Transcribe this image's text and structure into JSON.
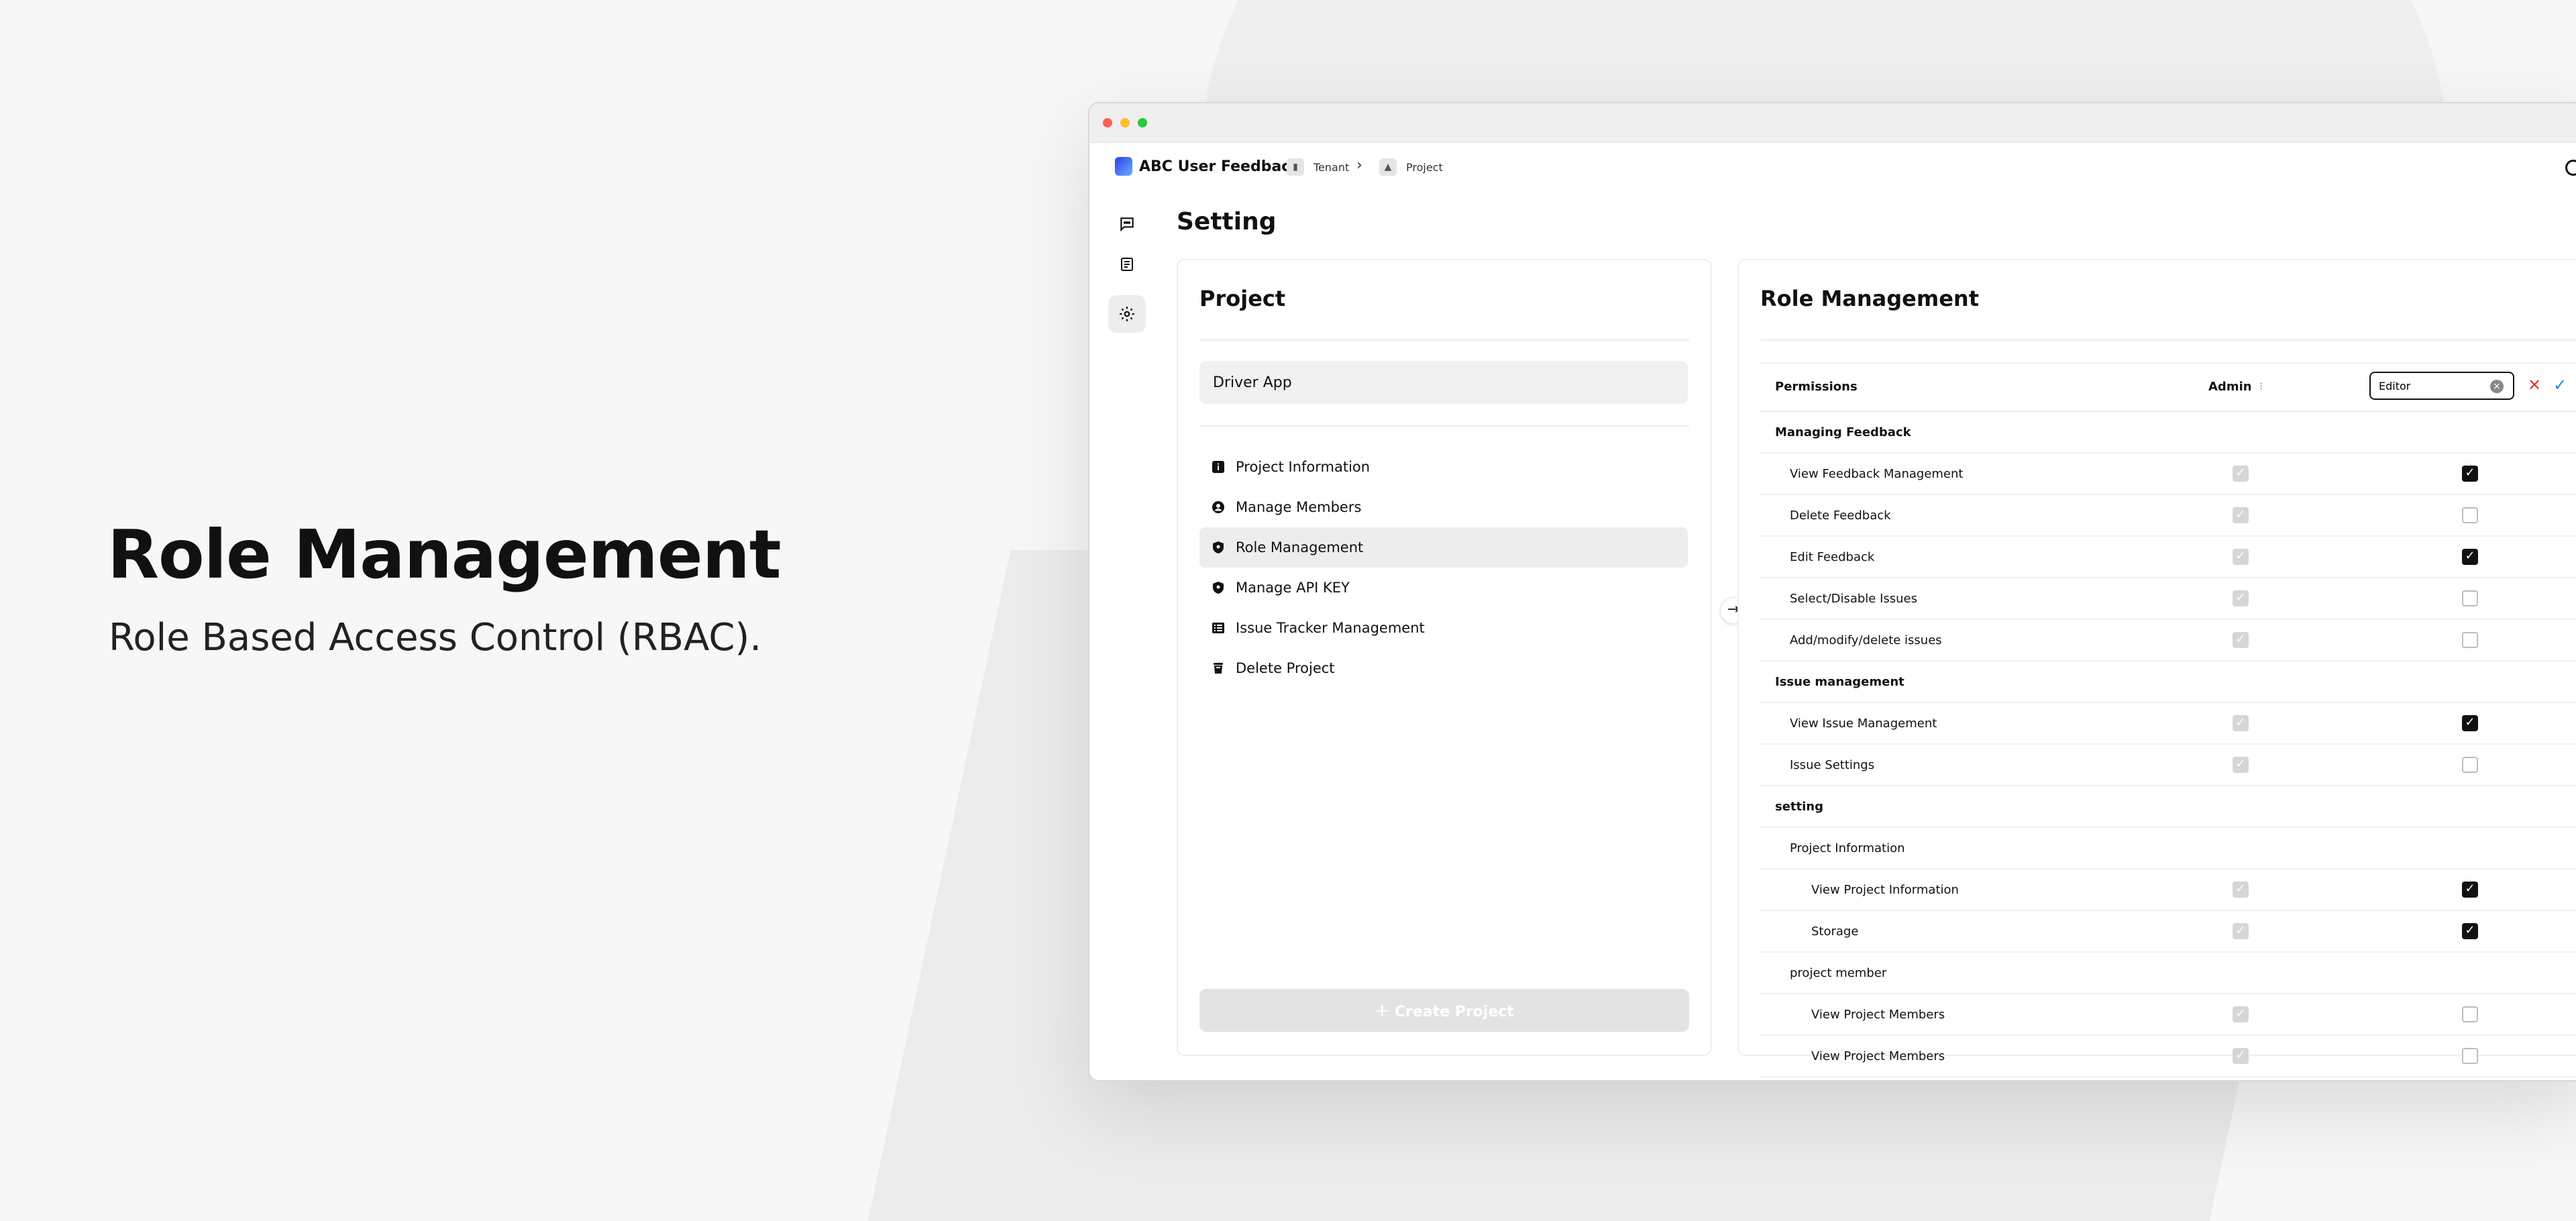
{
  "hero": {
    "title": "Role Management",
    "subtitle": "Role Based Access Control (RBAC)."
  },
  "app": {
    "name": "ABC User Feedback",
    "breadcrumb": [
      {
        "icon": "tenant-icon",
        "label": "Tenant"
      },
      {
        "icon": "project-icon",
        "label": "Project"
      }
    ]
  },
  "sidebar_nav": [
    {
      "icon": "feedback-icon",
      "active": false
    },
    {
      "icon": "issue-icon",
      "active": false
    },
    {
      "icon": "gear-icon",
      "active": true
    }
  ],
  "page": {
    "title": "Setting"
  },
  "project_panel": {
    "title": "Project",
    "selected_project": "Driver App",
    "menu": [
      {
        "icon": "info-icon",
        "label": "Project Information",
        "active": false
      },
      {
        "icon": "user-circle-icon",
        "label": "Manage Members",
        "active": false
      },
      {
        "icon": "shield-icon",
        "label": "Role Management",
        "active": true
      },
      {
        "icon": "shield-icon",
        "label": "Manage API KEY",
        "active": false
      },
      {
        "icon": "list-icon",
        "label": "Issue Tracker Management",
        "active": false
      },
      {
        "icon": "trash-icon",
        "label": "Delete Project",
        "active": false
      }
    ],
    "create_button": "Create Project"
  },
  "role_panel": {
    "title": "Role Management",
    "columns": {
      "permissions": "Permissions",
      "admin": "Admin",
      "admin_cursor": "⁝",
      "editor_value": "Editor"
    },
    "rows": [
      {
        "level": "group",
        "label": "Managing Feedback"
      },
      {
        "level": "sub",
        "label": "View Feedback Management",
        "admin": true,
        "editor": true
      },
      {
        "level": "sub",
        "label": "Delete Feedback",
        "admin": true,
        "editor": false
      },
      {
        "level": "sub",
        "label": "Edit Feedback",
        "admin": true,
        "editor": true
      },
      {
        "level": "sub",
        "label": "Select/Disable Issues",
        "admin": true,
        "editor": false
      },
      {
        "level": "sub",
        "label": "Add/modify/delete issues",
        "admin": true,
        "editor": false
      },
      {
        "level": "group",
        "label": "Issue management"
      },
      {
        "level": "sub",
        "label": "View Issue Management",
        "admin": true,
        "editor": true
      },
      {
        "level": "sub",
        "label": "Issue Settings",
        "admin": true,
        "editor": false
      },
      {
        "level": "group",
        "label": "setting"
      },
      {
        "level": "sub-plain",
        "label": "Project Information"
      },
      {
        "level": "subsub",
        "label": "View Project Information",
        "admin": true,
        "editor": true
      },
      {
        "level": "subsub",
        "label": "Storage",
        "admin": true,
        "editor": true
      },
      {
        "level": "sub-plain",
        "label": "project member"
      },
      {
        "level": "subsub",
        "label": "View Project Members",
        "admin": true,
        "editor": false
      },
      {
        "level": "subsub",
        "label": "View Project Members",
        "admin": true,
        "editor": false
      }
    ]
  }
}
